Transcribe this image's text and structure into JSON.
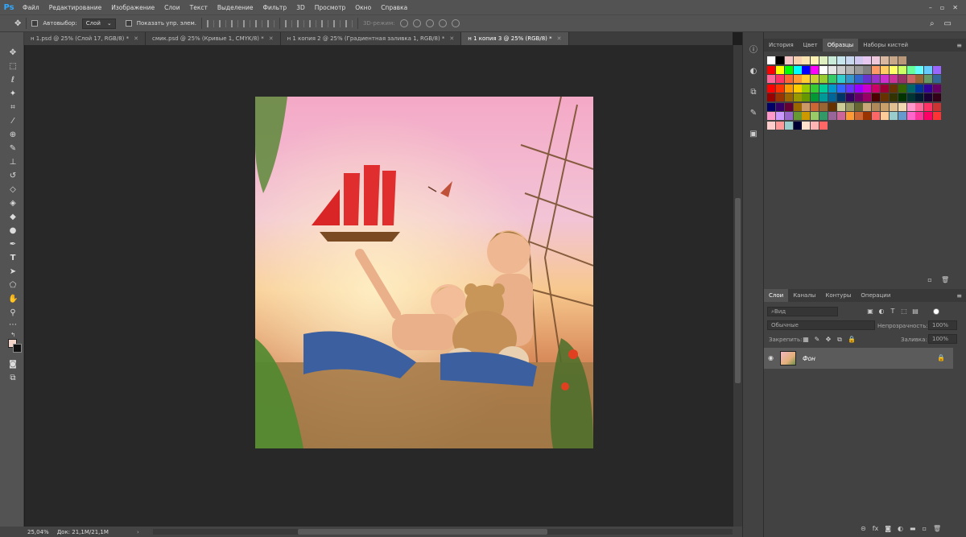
{
  "app": {
    "logo": "Ps",
    "menu": [
      "Файл",
      "Редактирование",
      "Изображение",
      "Слои",
      "Текст",
      "Выделение",
      "Фильтр",
      "3D",
      "Просмотр",
      "Окно",
      "Справка"
    ],
    "window_controls": [
      "–",
      "▫",
      "✕"
    ]
  },
  "options": {
    "autoselect_label": "Автовыбор:",
    "autoselect_value": "Слой",
    "show_controls_label": "Показать упр. элем.",
    "mode3d_label": "3D-режим:"
  },
  "tabs": [
    {
      "label": "н 1.psd @ 25% (Слой 17, RGB/8) *",
      "active": false
    },
    {
      "label": "смик.psd @ 25% (Кривые 1, CMYK/8) *",
      "active": false
    },
    {
      "label": "н 1 копия 2 @ 25% (Градиентная заливка 1, RGB/8) *",
      "active": false
    },
    {
      "label": "н 1 копия 3 @ 25% (RGB/8) *",
      "active": true
    }
  ],
  "status": {
    "zoom": "25,04%",
    "doc": "Док: 21,1M/21,1M"
  },
  "panels": {
    "top_tabs": [
      "История",
      "Цвет",
      "Образцы",
      "Наборы кистей"
    ],
    "top_active": "Образцы",
    "layers_tabs": [
      "Слои",
      "Каналы",
      "Контуры",
      "Операции"
    ],
    "layers_active": "Слои",
    "filter_placeholder": "Вид",
    "blend_mode": "Обычные",
    "opacity_label": "Непрозрачность:",
    "opacity_value": "100%",
    "lock_label": "Закрепить:",
    "fill_label": "Заливка:",
    "fill_value": "100%",
    "layer_name": "Фон"
  },
  "colors": {
    "accent": "#31a8ff",
    "panel_bg": "#424242",
    "ui_bg": "#535353"
  },
  "swatches": [
    [
      "#ffffff",
      "#000000",
      "#f6c6c6",
      "#f7d0b0",
      "#f9e3b0",
      "#fff2b3",
      "#e0f0c0",
      "#c8ecd8",
      "#c8e6ee",
      "#c8d8f0",
      "#d0c8f0",
      "#e6c8f0",
      "#f0c8dc",
      "#d8b8a0",
      "#c8a888",
      "#b89878"
    ],
    [
      "#ff0000",
      "#ffff00",
      "#00ff00",
      "#00ffff",
      "#0000ff",
      "#ff00ff",
      "#ffffff",
      "#e6e6e6",
      "#cccccc",
      "#b3b3b3",
      "#999999",
      "#808080",
      "#ff9966",
      "#ffcc66",
      "#ffff66",
      "#ccff66",
      "#66ff99",
      "#66ffff",
      "#66ccff",
      "#9966ff"
    ],
    [
      "#ff6699",
      "#ff3366",
      "#ff6633",
      "#ff9933",
      "#ffcc33",
      "#cccc33",
      "#99cc33",
      "#33cc66",
      "#33cccc",
      "#3399cc",
      "#3366cc",
      "#6633cc",
      "#9933cc",
      "#cc33cc",
      "#cc3399",
      "#993366",
      "#cc6666",
      "#996633",
      "#669966",
      "#336699"
    ],
    [
      "#ff0000",
      "#ff3300",
      "#ff9900",
      "#ffcc00",
      "#99cc00",
      "#33cc33",
      "#00cc99",
      "#0099cc",
      "#3366ff",
      "#6633ff",
      "#9900ff",
      "#cc00cc",
      "#cc0066",
      "#990033",
      "#663300",
      "#336600",
      "#006666",
      "#003399",
      "#330099",
      "#660066"
    ],
    [
      "#990000",
      "#993300",
      "#996600",
      "#999900",
      "#669900",
      "#009933",
      "#009999",
      "#006699",
      "#003366",
      "#330066",
      "#660066",
      "#990066",
      "#4d0000",
      "#663300",
      "#333300",
      "#003300",
      "#003333",
      "#001a33",
      "#1a0033",
      "#33001a"
    ],
    [
      "#000066",
      "#330066",
      "#660033",
      "#996600",
      "#cc9966",
      "#cc6633",
      "#996633",
      "#663300",
      "#cccc99",
      "#999966",
      "#666633",
      "#c8a878",
      "#b08858",
      "#c9a06a",
      "#e0c090",
      "#f0d8b0",
      "#ff99cc",
      "#ff6699",
      "#ff3366",
      "#cc3333"
    ],
    [
      "#ff99cc",
      "#cc99ff",
      "#9966cc",
      "#669933",
      "#cc9900",
      "#99cc66",
      "#339966",
      "#996699",
      "#cc6699",
      "#ff9933",
      "#cc6633",
      "#993300",
      "#ff6666",
      "#ffcc99",
      "#99cccc",
      "#6699cc",
      "#ff66cc",
      "#ff3399",
      "#ff0066",
      "#ff3333"
    ],
    [
      "#ffcccc",
      "#ff9999",
      "#99cccc",
      "#000033",
      "#ffe0cc",
      "#ffb3b3",
      "#ff6666"
    ]
  ]
}
